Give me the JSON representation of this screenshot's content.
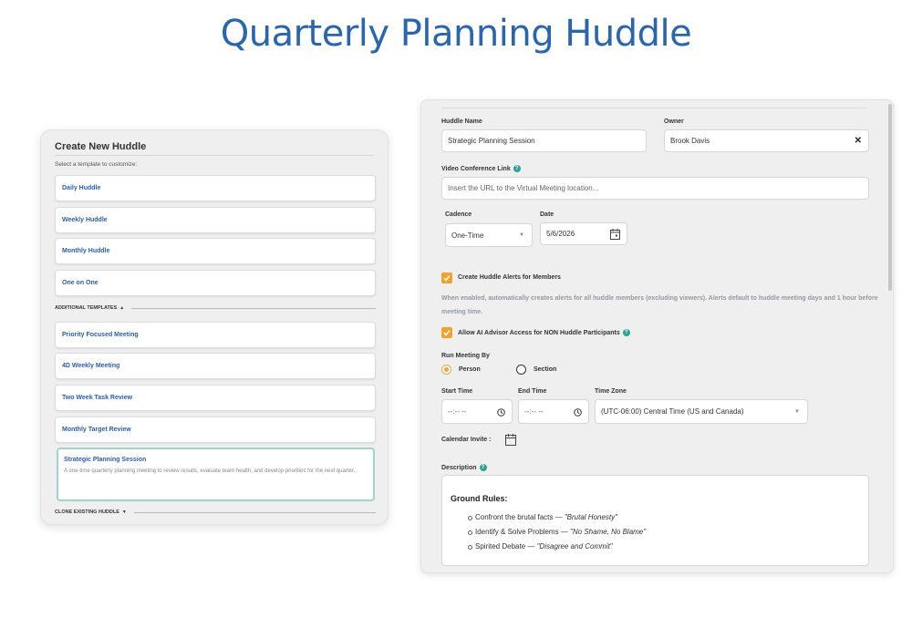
{
  "page": {
    "title": "Quarterly Planning Huddle"
  },
  "left_panel": {
    "title": "Create New Huddle",
    "hint": "Select a template to customize:",
    "templates": [
      {
        "label": "Daily Huddle"
      },
      {
        "label": "Weekly Huddle"
      },
      {
        "label": "Monthly Huddle"
      },
      {
        "label": "One on One"
      }
    ],
    "additional_header": "ADDITIONAL TEMPLATES",
    "additional_arrow": "▲",
    "additional_templates": [
      {
        "label": "Priority Focused Meeting"
      },
      {
        "label": "4D Weekly Meeting"
      },
      {
        "label": "Two Week Task Review"
      },
      {
        "label": "Monthly Target Review"
      }
    ],
    "selected_template": {
      "label": "Strategic Planning Session",
      "description": "A one-time quarterly planning meeting to review results, evaluate team health, and develop priorities for the next quarter."
    },
    "clone_header": "CLONE EXISTING HUDDLE",
    "clone_arrow": "▼"
  },
  "form": {
    "huddle_name_label": "Huddle Name",
    "huddle_name_value": "Strategic Planning Session",
    "owner_label": "Owner",
    "owner_value": "Brook Davis",
    "owner_clear": "✕",
    "video_label": "Video Conference Link",
    "video_placeholder": "Insert the URL to the Virtual Meeting location...",
    "cadence_label": "Cadence",
    "cadence_value": "One-Time",
    "date_label": "Date",
    "date_value": "5/6/2026",
    "alerts_label": "Create Huddle Alerts for Members",
    "alerts_checked": true,
    "alerts_note": "When enabled, automatically creates alerts for all huddle members (excluding viewers). Alerts default to huddle meeting days and 1 hour before meeting time.",
    "ai_label": "Allow AI Advisor Access for NON Huddle Participants",
    "ai_checked": true,
    "run_by_label": "Run Meeting By",
    "run_by_options": [
      "Person",
      "Section"
    ],
    "run_by_selected": "Person",
    "start_time_label": "Start Time",
    "start_time_value": "--:-- --",
    "end_time_label": "End Time",
    "end_time_value": "--:-- --",
    "timezone_label": "Time Zone",
    "timezone_value": "(UTC-06:00) Central Time (US and Canada)",
    "calendar_invite_label": "Calendar Invite :",
    "description_label": "Description",
    "description": {
      "heading": "Ground Rules:",
      "items": [
        {
          "text": "Confront the brutal facts — ",
          "quote": "\"Brutal Honesty\""
        },
        {
          "text": "Identify & Solve Problems — ",
          "quote": "\"No Shame, No Blame\""
        },
        {
          "text": "Spirited Debate — ",
          "quote": "\"Disagree and Commit\""
        }
      ]
    }
  },
  "colors": {
    "title_blue": "#2a66ad",
    "link_blue": "#2a5da8",
    "accent_orange": "#f4a12b",
    "help_teal": "#2aa39a",
    "selected_border": "#9dd6c8"
  },
  "icons": [
    "help-icon",
    "calendar-icon",
    "clock-icon",
    "clear-icon",
    "check-icon",
    "caret-down-icon"
  ]
}
